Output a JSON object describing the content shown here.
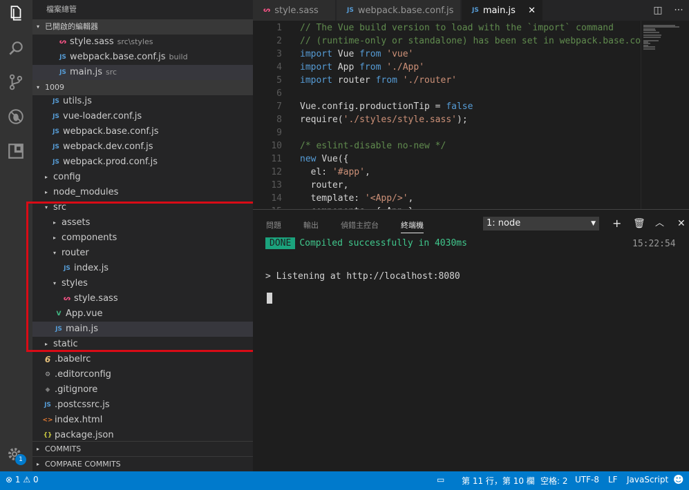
{
  "activity": {
    "icons": [
      "explorer-icon",
      "search-icon",
      "source-control-icon",
      "debug-icon",
      "extensions-icon"
    ],
    "notification_count": "1"
  },
  "sidebar": {
    "title": "檔案總管",
    "open_editors": {
      "label": "已開啟的編輯器",
      "items": [
        {
          "name": "style.sass",
          "desc": "src\\styles",
          "type": "sass"
        },
        {
          "name": "webpack.base.conf.js",
          "desc": "build",
          "type": "js"
        },
        {
          "name": "main.js",
          "desc": "src",
          "type": "js"
        }
      ]
    },
    "project": {
      "label": "1009",
      "items": [
        {
          "name": "utils.js",
          "type": "js"
        },
        {
          "name": "vue-loader.conf.js",
          "type": "js"
        },
        {
          "name": "webpack.base.conf.js",
          "type": "js"
        },
        {
          "name": "webpack.dev.conf.js",
          "type": "js"
        },
        {
          "name": "webpack.prod.conf.js",
          "type": "js"
        },
        {
          "name": "config",
          "type": "folder"
        },
        {
          "name": "node_modules",
          "type": "folder"
        },
        {
          "name": "src",
          "type": "folder-open"
        },
        {
          "name": "assets",
          "type": "folder"
        },
        {
          "name": "components",
          "type": "folder"
        },
        {
          "name": "router",
          "type": "folder-open"
        },
        {
          "name": "index.js",
          "type": "js"
        },
        {
          "name": "styles",
          "type": "folder-open"
        },
        {
          "name": "style.sass",
          "type": "sass"
        },
        {
          "name": "App.vue",
          "type": "vue"
        },
        {
          "name": "main.js",
          "type": "js"
        },
        {
          "name": "static",
          "type": "folder"
        },
        {
          "name": ".babelrc",
          "type": "babel"
        },
        {
          "name": ".editorconfig",
          "type": "cfg"
        },
        {
          "name": ".gitignore",
          "type": "git"
        },
        {
          "name": ".postcssrc.js",
          "type": "js"
        },
        {
          "name": "index.html",
          "type": "html"
        },
        {
          "name": "package.json",
          "type": "json"
        }
      ]
    },
    "commits_label": "COMMITS",
    "compare_label": "COMPARE COMMITS"
  },
  "tabs": [
    {
      "name": "style.sass",
      "type": "sass"
    },
    {
      "name": "webpack.base.conf.js",
      "type": "js"
    },
    {
      "name": "main.js",
      "type": "js",
      "active": true
    }
  ],
  "editor": {
    "lines": [
      [
        [
          "com",
          "// The Vue build version to load with the `import` command"
        ]
      ],
      [
        [
          "com",
          "// (runtime-only or standalone) has been set in webpack.base.conf"
        ]
      ],
      [
        [
          "kw",
          "import "
        ],
        [
          "def",
          "Vue "
        ],
        [
          "kw",
          "from "
        ],
        [
          "str",
          "'vue'"
        ]
      ],
      [
        [
          "kw",
          "import "
        ],
        [
          "def",
          "App "
        ],
        [
          "kw",
          "from "
        ],
        [
          "str",
          "'./App'"
        ]
      ],
      [
        [
          "kw",
          "import "
        ],
        [
          "def",
          "router "
        ],
        [
          "kw",
          "from "
        ],
        [
          "str",
          "'./router'"
        ]
      ],
      [],
      [
        [
          "def",
          "Vue.config.productionTip = "
        ],
        [
          "kw",
          "false"
        ]
      ],
      [
        [
          "def",
          "require("
        ],
        [
          "str",
          "'./styles/style.sass'"
        ],
        [
          "def",
          ");"
        ]
      ],
      [],
      [
        [
          "com",
          "/* eslint-disable no-new */"
        ]
      ],
      [
        [
          "kw",
          "new "
        ],
        [
          "def",
          "Vue({"
        ]
      ],
      [
        [
          "def",
          "  el: "
        ],
        [
          "str",
          "'#app'"
        ],
        [
          "def",
          ","
        ]
      ],
      [
        [
          "def",
          "  router,"
        ]
      ],
      [
        [
          "def",
          "  template: "
        ],
        [
          "str",
          "'<App/>'"
        ],
        [
          "def",
          ","
        ]
      ],
      [
        [
          "def",
          "  components: { App }"
        ]
      ]
    ]
  },
  "panel": {
    "tabs": [
      "問題",
      "輸出",
      "偵錯主控台",
      "終端機"
    ],
    "active_tab": "終端機",
    "terminal_select": "1: node",
    "done_badge": "DONE",
    "compiled_msg": "Compiled successfully in 4030ms",
    "timestamp": "15:22:54",
    "listen_msg": "> Listening at http://localhost:8080"
  },
  "status": {
    "errors": "1",
    "warnings": "0",
    "position": "第 11 行，第 10 欄",
    "spaces": "空格: 2",
    "encoding": "UTF-8",
    "eol": "LF",
    "language": "JavaScript"
  }
}
